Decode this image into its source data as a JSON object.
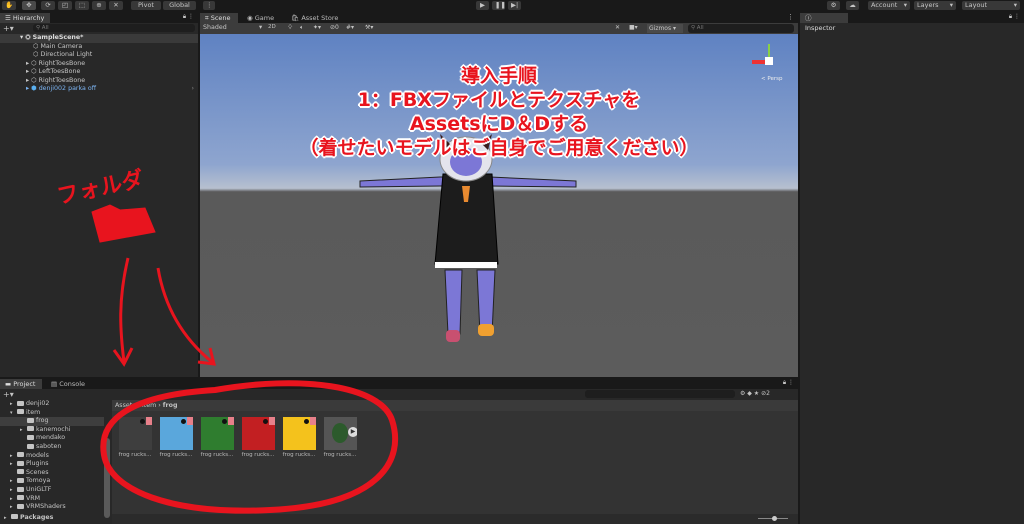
{
  "toolbar": {
    "tools": [
      "hand-tool",
      "move-tool",
      "rotate-tool",
      "scale-tool",
      "rect-tool",
      "transform-tool",
      "custom-tool"
    ],
    "pivot": "Pivot",
    "global": "Global",
    "account": "Account",
    "layers": "Layers",
    "layout": "Layout"
  },
  "hierarchy": {
    "title": "Hierarchy",
    "search_placeholder": "All",
    "scene": "SampleScene*",
    "items": [
      {
        "label": "Main Camera",
        "expandable": false
      },
      {
        "label": "Directional Light",
        "expandable": false
      },
      {
        "label": "RightToesBone",
        "expandable": true
      },
      {
        "label": "LeftToesBone",
        "expandable": true
      },
      {
        "label": "RightToesBone",
        "expandable": true
      },
      {
        "label": "denji002 parka off",
        "expandable": true,
        "prefab": true
      }
    ]
  },
  "scene": {
    "tabs": [
      "Scene",
      "Game",
      "Asset Store"
    ],
    "shading": "Shaded",
    "mode_2d": "2D",
    "gizmos": "Gizmos",
    "search_placeholder": "All",
    "persp": "< Persp",
    "layer_count": "0"
  },
  "inspector": {
    "title": "Inspector"
  },
  "annotation": {
    "lines": [
      "導入手順",
      "1：FBXファイルとテクスチャを",
      "AssetsにD＆Dする",
      "（着せたいモデルはご自身でご用意ください）"
    ],
    "folder_note": "フォルダ",
    "color": "#e8141e"
  },
  "project": {
    "tabs": [
      "Project",
      "Console"
    ],
    "tree": [
      {
        "label": "denji02",
        "depth": 1,
        "arrow": true
      },
      {
        "label": "item",
        "depth": 1,
        "arrow": true,
        "open": true
      },
      {
        "label": "frog",
        "depth": 2,
        "selected": true
      },
      {
        "label": "kanemochi",
        "depth": 2,
        "arrow": true
      },
      {
        "label": "mendako",
        "depth": 2
      },
      {
        "label": "saboten",
        "depth": 2
      },
      {
        "label": "models",
        "depth": 1,
        "arrow": true
      },
      {
        "label": "Plugins",
        "depth": 1,
        "arrow": true
      },
      {
        "label": "Scenes",
        "depth": 1
      },
      {
        "label": "Tomoya",
        "depth": 1,
        "arrow": true
      },
      {
        "label": "UniGLTF",
        "depth": 1,
        "arrow": true
      },
      {
        "label": "VRM",
        "depth": 1,
        "arrow": true
      },
      {
        "label": "VRMShaders",
        "depth": 1,
        "arrow": true
      },
      {
        "label": "Packages",
        "depth": 0,
        "arrow": true
      }
    ],
    "breadcrumb": [
      "Assets",
      "item",
      "frog"
    ],
    "hidden_count": "2",
    "assets": [
      {
        "label": "frog rucks...",
        "color": "#3e3e3e"
      },
      {
        "label": "frog rucks...",
        "color": "#5aa7dc"
      },
      {
        "label": "frog rucks...",
        "color": "#2f7d2f"
      },
      {
        "label": "frog rucks...",
        "color": "#c21f22"
      },
      {
        "label": "frog rucks...",
        "color": "#f4c21c"
      },
      {
        "label": "frog rucks...",
        "color": "#555555"
      }
    ]
  }
}
